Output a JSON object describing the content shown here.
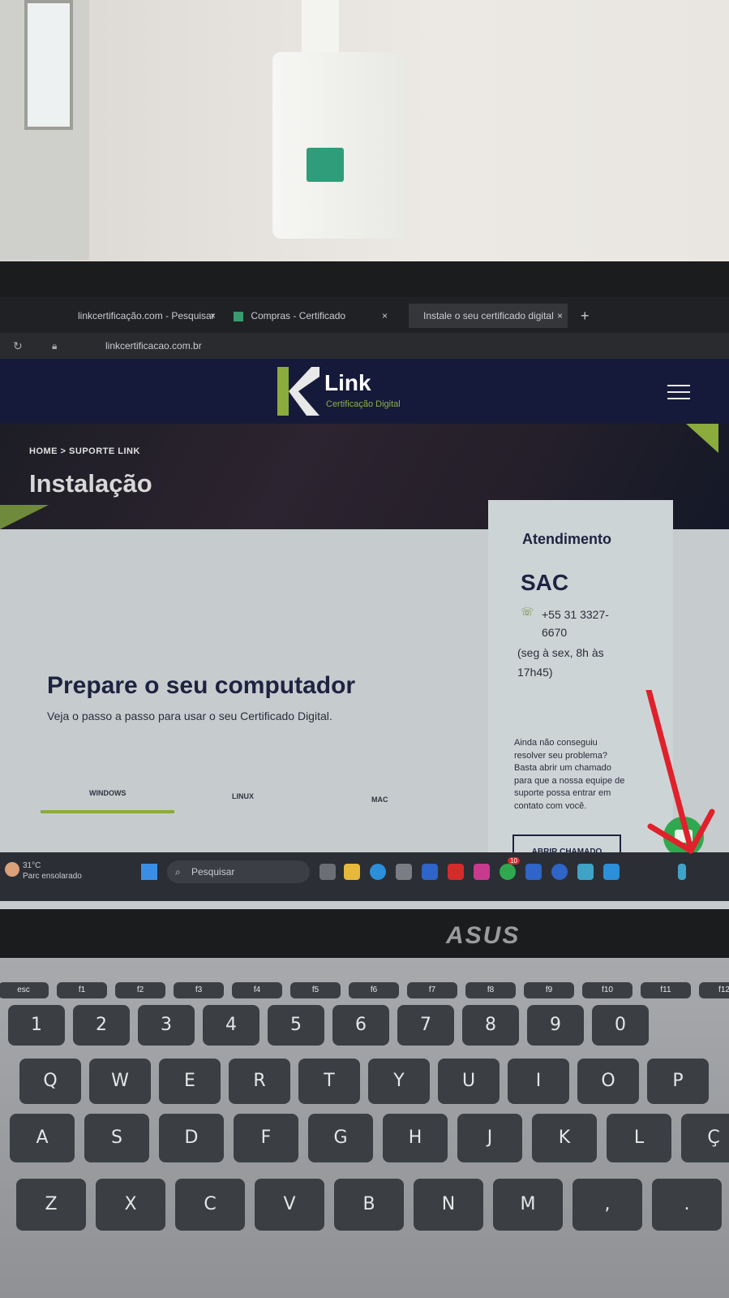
{
  "browser": {
    "tabs": [
      {
        "label": "linkcertificação.com - Pesquisar",
        "close": "×"
      },
      {
        "label": "Compras - Certificado",
        "close": "×"
      },
      {
        "label": "Instale o seu certificado digital",
        "close": "×"
      }
    ],
    "new_tab": "+",
    "url": "linkcertificacao.com.br"
  },
  "site": {
    "logo_text": "Link",
    "logo_sub": "Certificação Digital",
    "breadcrumb": "HOME  >  SUPORTE LINK",
    "page_title": "Instalação",
    "prep_title": "Prepare o seu computador",
    "prep_sub": "Veja o passo a passo para usar o seu Certificado Digital.",
    "os_tabs": [
      "WINDOWS",
      "LINUX",
      "MAC"
    ],
    "contact": {
      "heading": "Atendimento",
      "sac": "SAC",
      "phone": "+55 31 3327-6670",
      "hours": "(seg à sex, 8h às 17h45)",
      "help": "Ainda não conseguiu resolver seu problema? Basta abrir um chamado para que a nossa equipe de suporte possa entrar em contato com você.",
      "button": "ABRIR CHAMADO"
    }
  },
  "taskbar": {
    "temperature": "31°C",
    "weather": "Parc ensolarado",
    "search_placeholder": "Pesquisar",
    "notification_count": "10"
  },
  "brand": "ASUS",
  "keyboard": {
    "fn_row": [
      "esc",
      "f1",
      "f2",
      "f3",
      "f4",
      "f5",
      "f6",
      "f7",
      "f8",
      "f9",
      "f10",
      "f11",
      "f12"
    ],
    "num_row": [
      "1",
      "2",
      "3",
      "4",
      "5",
      "6",
      "7",
      "8",
      "9",
      "0"
    ],
    "row_q": [
      "Q",
      "W",
      "E",
      "R",
      "T",
      "Y",
      "U",
      "I",
      "O",
      "P"
    ],
    "row_a": [
      "A",
      "S",
      "D",
      "F",
      "G",
      "H",
      "J",
      "K",
      "L",
      "Ç"
    ],
    "row_z": [
      "Z",
      "X",
      "C",
      "V",
      "B",
      "N",
      "M",
      ",",
      "."
    ]
  },
  "colors": {
    "site_navy": "#1d2340",
    "accent_green": "#8bab3c",
    "whatsapp_green": "#2fa84f",
    "arrow_red": "#e0202a"
  }
}
